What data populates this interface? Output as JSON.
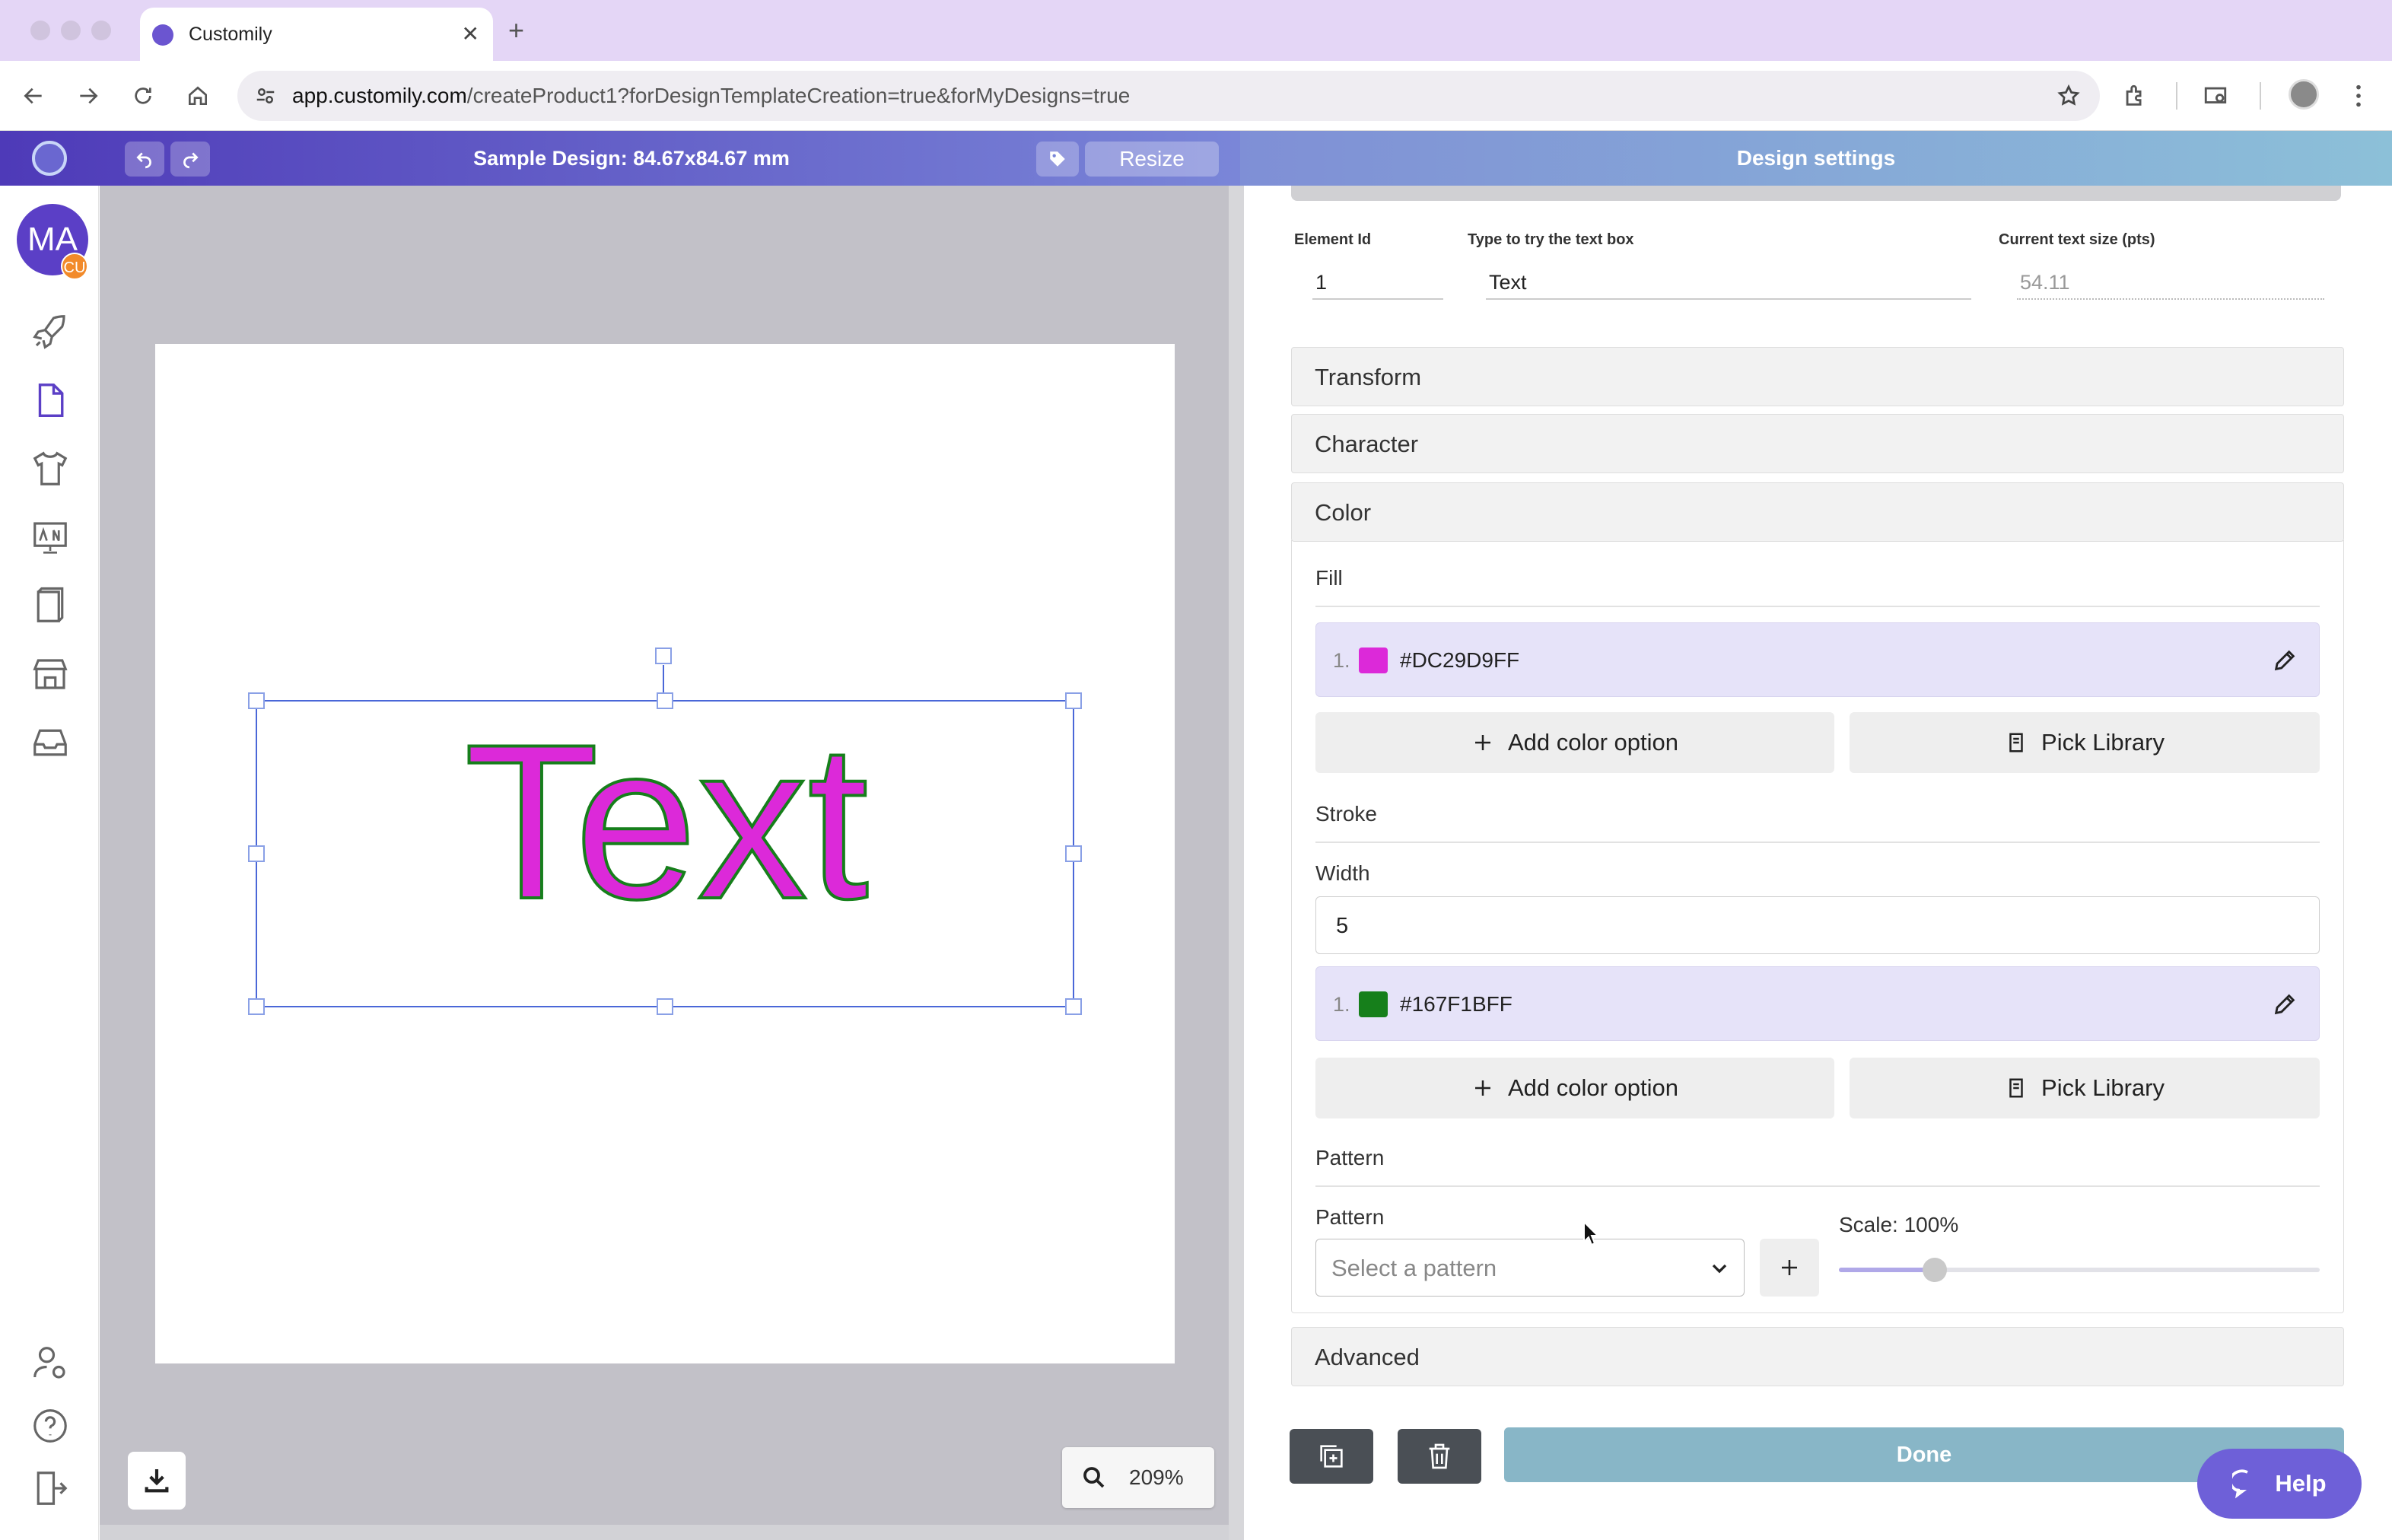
{
  "browser": {
    "tab_title": "Customily",
    "close_glyph": "✕",
    "new_tab_glyph": "+",
    "url_host": "app.customily.com",
    "url_path": "/createProduct1?forDesignTemplateCreation=true&forMyDesigns=true"
  },
  "header": {
    "design_title": "Sample Design: 84.67x84.67 mm",
    "resize_label": "Resize",
    "settings_title": "Design settings"
  },
  "sidebar": {
    "user_initials": "MA",
    "user_badge": "CU",
    "items": [
      "rocket-icon",
      "document-icon",
      "tshirt-icon",
      "presentation-icon",
      "book-icon",
      "store-icon",
      "inbox-icon"
    ],
    "bottom_items": [
      "user-settings-icon",
      "help-circle-icon",
      "exit-icon"
    ]
  },
  "canvas": {
    "design_text": "Text",
    "zoom_level": "209%"
  },
  "fields": {
    "element_id_label": "Element Id",
    "element_id_value": "1",
    "try_text_label": "Type to try the text box",
    "try_text_value": "Text",
    "text_size_label": "Current text size (pts)",
    "text_size_value": "54.11"
  },
  "sections": {
    "transform": "Transform",
    "character": "Character",
    "color": "Color",
    "advanced": "Advanced"
  },
  "fill": {
    "label": "Fill",
    "num": "1.",
    "hex": "#DC29D9FF",
    "swatch": "#DC29D9",
    "add_option": "Add color option",
    "pick_library": "Pick Library"
  },
  "stroke": {
    "label": "Stroke",
    "width_label": "Width",
    "width_value": "5",
    "num": "1.",
    "hex": "#167F1BFF",
    "swatch": "#167F1B",
    "add_option": "Add color option",
    "pick_library": "Pick Library"
  },
  "pattern": {
    "section_label": "Pattern",
    "field_label": "Pattern",
    "placeholder": "Select a pattern",
    "scale_label": "Scale: 100%",
    "scale_level": 0.2
  },
  "footer": {
    "done_label": "Done",
    "help_label": "Help"
  },
  "colors": {
    "accent": "#5b3fc6",
    "done": "#88b6c7",
    "help": "#6e60d8"
  }
}
